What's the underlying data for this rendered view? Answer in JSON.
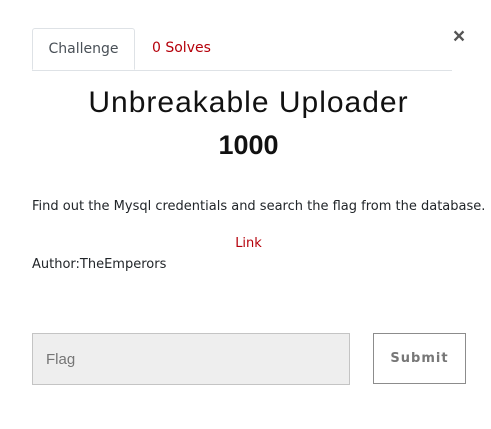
{
  "modal": {
    "close_label": "×",
    "tabs": [
      {
        "label": "Challenge"
      },
      {
        "label": "0 Solves"
      }
    ],
    "challenge": {
      "name": "Unbreakable Uploader",
      "value": "1000",
      "description": "Find out the Mysql credentials and search the flag from the database.",
      "link_label": "Link",
      "author": "Author:TheEmperors"
    },
    "form": {
      "flag_placeholder": "Flag",
      "flag_value": "",
      "submit_label": "Submit"
    }
  },
  "colors": {
    "accent": "#b5000a",
    "input_bg": "#eeeeee"
  }
}
